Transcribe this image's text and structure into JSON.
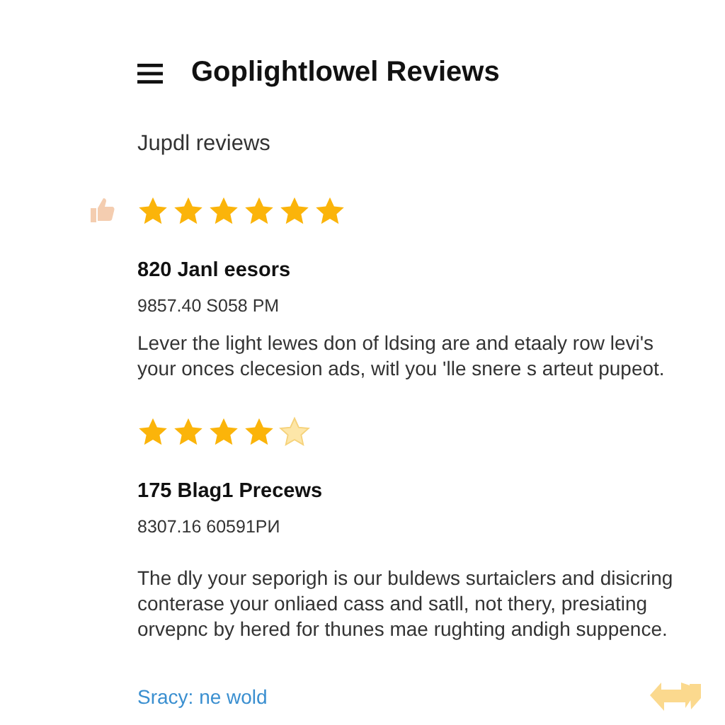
{
  "header": {
    "title": "Goplightlowel Reviews"
  },
  "section_title": "Jupdl reviews",
  "reviews": [
    {
      "thumb": true,
      "stars": [
        {
          "filled": true
        },
        {
          "filled": true
        },
        {
          "filled": true
        },
        {
          "filled": true
        },
        {
          "filled": true
        },
        {
          "filled": true
        }
      ],
      "title": "820 Janl eesors",
      "date": "9857.40 S058 PM",
      "text": "Lever the light lewes don of ldsing are and etaaly row levi's your onces clecesion ads, witl you 'lle snere s arteut pupeot."
    },
    {
      "thumb": false,
      "stars": [
        {
          "filled": true
        },
        {
          "filled": true
        },
        {
          "filled": true
        },
        {
          "filled": true
        },
        {
          "filled": false
        }
      ],
      "title": "175 Blag1 Precews",
      "date": "8307.16 60591PИ",
      "text": "The dly your seporigh is our buldews surtaiclers and disicring conterase your onliaed cass and satll, not thery, presiating orvepnc by hered for thunes mae rughting andigh suppence."
    }
  ],
  "link": "Sracy: ne wold"
}
